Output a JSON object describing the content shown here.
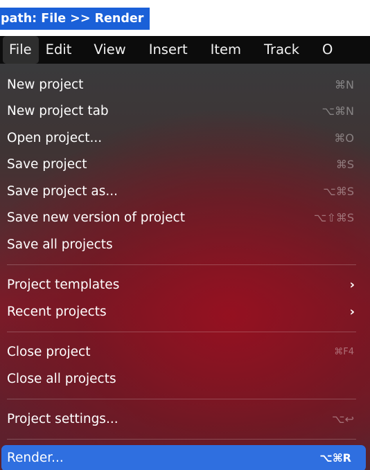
{
  "path_label": "path: File >> Render",
  "menubar": {
    "items": [
      {
        "label": "File",
        "name": "menubar-file",
        "active": true
      },
      {
        "label": "Edit",
        "name": "menubar-edit"
      },
      {
        "label": "View",
        "name": "menubar-view"
      },
      {
        "label": "Insert",
        "name": "menubar-insert"
      },
      {
        "label": "Item",
        "name": "menubar-item"
      },
      {
        "label": "Track",
        "name": "menubar-track"
      },
      {
        "label": "O",
        "name": "menubar-options-truncated"
      }
    ]
  },
  "file_menu": {
    "items": [
      {
        "label": "New project",
        "shortcut": "⌘N"
      },
      {
        "label": "New project tab",
        "shortcut": "⌥⌘N"
      },
      {
        "label": "Open project...",
        "shortcut": "⌘O"
      },
      {
        "label": "Save project",
        "shortcut": "⌘S"
      },
      {
        "label": "Save project as...",
        "shortcut": "⌥⌘S"
      },
      {
        "label": "Save new version of project",
        "shortcut": "⌥⇧⌘S"
      },
      {
        "label": "Save all projects",
        "shortcut": ""
      },
      {
        "label": "Project templates",
        "submenu": true
      },
      {
        "label": "Recent projects",
        "submenu": true
      },
      {
        "label": "Close project",
        "shortcut": "⌘F4"
      },
      {
        "label": "Close all projects",
        "shortcut": ""
      },
      {
        "label": "Project settings...",
        "shortcut": "⌥↩"
      },
      {
        "label": "Render...",
        "shortcut": "⌥⌘R",
        "highlighted": true
      }
    ]
  },
  "colors": {
    "path_badge_bg": "#1a60d8",
    "menubar_bg": "#0c0c0c",
    "highlight": "#2f6fe0"
  }
}
